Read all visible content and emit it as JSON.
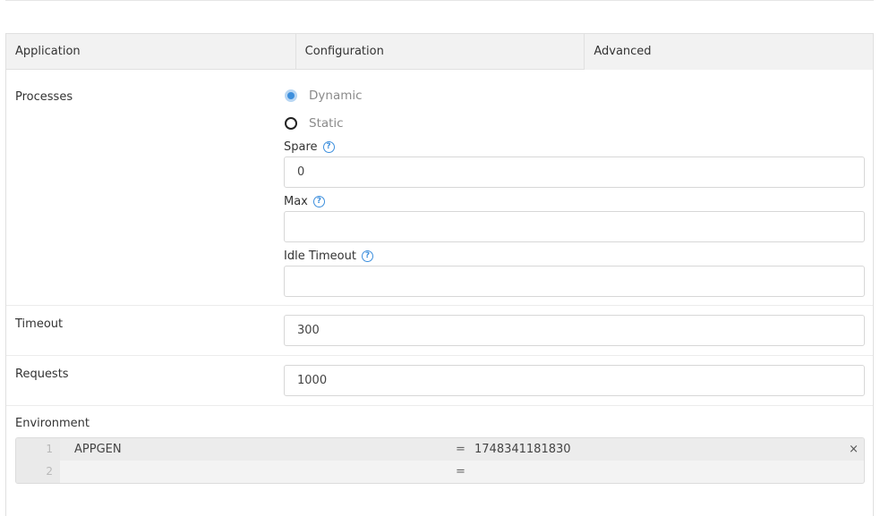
{
  "tabs": [
    "Application",
    "Configuration",
    "Advanced"
  ],
  "active_tab": "Advanced",
  "processes": {
    "label": "Processes",
    "options": [
      "Dynamic",
      "Static"
    ],
    "selected": "Dynamic",
    "spare": {
      "label": "Spare",
      "value": "0"
    },
    "max": {
      "label": "Max",
      "value": ""
    },
    "idle_timeout": {
      "label": "Idle Timeout",
      "value": ""
    },
    "help_glyph": "?"
  },
  "timeout": {
    "label": "Timeout",
    "value": "300"
  },
  "requests": {
    "label": "Requests",
    "value": "1000"
  },
  "environment": {
    "label": "Environment",
    "rows": [
      {
        "line": "1",
        "key": "APPGEN",
        "eq": "=",
        "value": "1748341181830",
        "remove": "×"
      },
      {
        "line": "2",
        "key": "",
        "eq": "=",
        "value": "",
        "remove": ""
      }
    ]
  },
  "colors": {
    "accent": "#3d8fdd",
    "tab_bg": "#f2f2f2",
    "border": "#e0e0e0"
  }
}
